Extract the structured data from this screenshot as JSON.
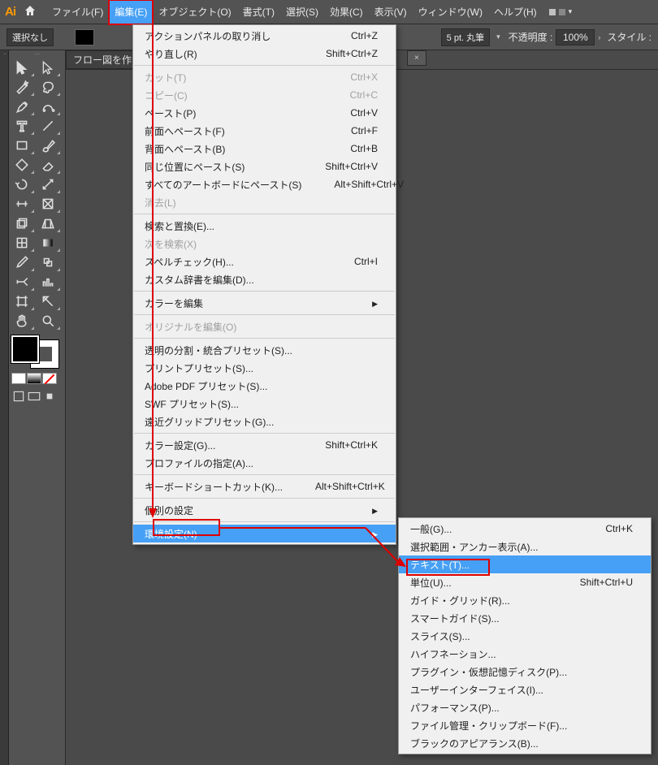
{
  "app": {
    "logo": "Ai"
  },
  "menubar": {
    "items": [
      {
        "label": "ファイル(F)"
      },
      {
        "label": "編集(E)",
        "open": true
      },
      {
        "label": "オブジェクト(O)"
      },
      {
        "label": "書式(T)"
      },
      {
        "label": "選択(S)"
      },
      {
        "label": "効果(C)"
      },
      {
        "label": "表示(V)"
      },
      {
        "label": "ウィンドウ(W)"
      },
      {
        "label": "ヘルプ(H)"
      }
    ]
  },
  "optionbar": {
    "selection_label": "選択なし",
    "stroke_pt": "5 pt. 丸筆",
    "opacity_label": "不透明度 :",
    "opacity_value": "100%",
    "style_label": "スタイル :"
  },
  "tabs": {
    "active": "フロー図を作りつ",
    "inactive_close": "×"
  },
  "edit_menu": {
    "groups": [
      [
        {
          "label": "アクションパネルの取り消し",
          "shortcut": "Ctrl+Z"
        },
        {
          "label": "やり直し(R)",
          "shortcut": "Shift+Ctrl+Z"
        }
      ],
      [
        {
          "label": "カット(T)",
          "shortcut": "Ctrl+X",
          "disabled": true
        },
        {
          "label": "コピー(C)",
          "shortcut": "Ctrl+C",
          "disabled": true
        },
        {
          "label": "ペースト(P)",
          "shortcut": "Ctrl+V"
        },
        {
          "label": "前面へペースト(F)",
          "shortcut": "Ctrl+F"
        },
        {
          "label": "背面へペースト(B)",
          "shortcut": "Ctrl+B"
        },
        {
          "label": "同じ位置にペースト(S)",
          "shortcut": "Shift+Ctrl+V"
        },
        {
          "label": "すべてのアートボードにペースト(S)",
          "shortcut": "Alt+Shift+Ctrl+V"
        },
        {
          "label": "消去(L)",
          "disabled": true
        }
      ],
      [
        {
          "label": "検索と置換(E)..."
        },
        {
          "label": "次を検索(X)",
          "disabled": true
        },
        {
          "label": "スペルチェック(H)...",
          "shortcut": "Ctrl+I"
        },
        {
          "label": "カスタム辞書を編集(D)..."
        }
      ],
      [
        {
          "label": "カラーを編集",
          "submenu": true
        }
      ],
      [
        {
          "label": "オリジナルを編集(O)",
          "disabled": true
        }
      ],
      [
        {
          "label": "透明の分割・統合プリセット(S)..."
        },
        {
          "label": "プリントプリセット(S)..."
        },
        {
          "label": "Adobe PDF プリセット(S)..."
        },
        {
          "label": "SWF プリセット(S)..."
        },
        {
          "label": "遠近グリッドプリセット(G)..."
        }
      ],
      [
        {
          "label": "カラー設定(G)...",
          "shortcut": "Shift+Ctrl+K"
        },
        {
          "label": "プロファイルの指定(A)..."
        }
      ],
      [
        {
          "label": "キーボードショートカット(K)...",
          "shortcut": "Alt+Shift+Ctrl+K"
        }
      ],
      [
        {
          "label": "個別の設定",
          "submenu": true
        }
      ],
      [
        {
          "label": "環境設定(N)",
          "submenu": true,
          "highlight": true
        }
      ]
    ]
  },
  "prefs_submenu": {
    "items": [
      {
        "label": "一般(G)...",
        "shortcut": "Ctrl+K"
      },
      {
        "label": "選択範囲・アンカー表示(A)..."
      },
      {
        "label": "テキスト(T)...",
        "highlight": true
      },
      {
        "label": "単位(U)...",
        "shortcut": "Shift+Ctrl+U"
      },
      {
        "label": "ガイド・グリッド(R)..."
      },
      {
        "label": "スマートガイド(S)..."
      },
      {
        "label": "スライス(S)..."
      },
      {
        "label": "ハイフネーション..."
      },
      {
        "label": "プラグイン・仮想記憶ディスク(P)..."
      },
      {
        "label": "ユーザーインターフェイス(I)..."
      },
      {
        "label": "パフォーマンス(P)..."
      },
      {
        "label": "ファイル管理・クリップボード(F)..."
      },
      {
        "label": "ブラックのアピアランス(B)..."
      }
    ]
  },
  "tools": [
    [
      "selection",
      "direct-selection"
    ],
    [
      "magic-wand",
      "lasso"
    ],
    [
      "pen",
      "curvature"
    ],
    [
      "type",
      "line"
    ],
    [
      "rectangle",
      "paintbrush"
    ],
    [
      "shaper",
      "eraser"
    ],
    [
      "rotate",
      "scale"
    ],
    [
      "width",
      "free-transform"
    ],
    [
      "shape-builder",
      "perspective"
    ],
    [
      "mesh",
      "gradient"
    ],
    [
      "eyedropper",
      "blend"
    ],
    [
      "symbol-sprayer",
      "column-graph"
    ],
    [
      "artboard",
      "slice"
    ],
    [
      "hand",
      "zoom"
    ]
  ]
}
